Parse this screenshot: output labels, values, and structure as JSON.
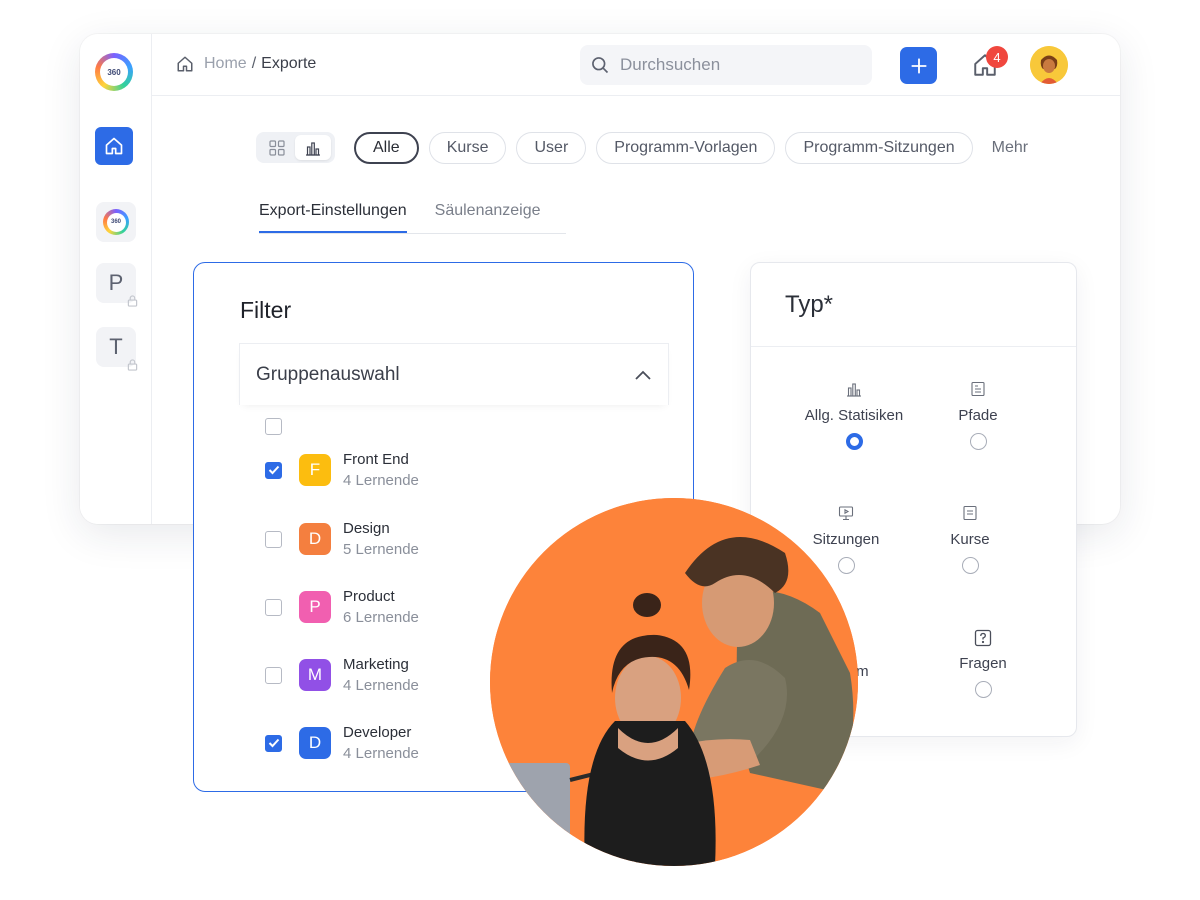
{
  "app": {
    "logo_text": "360"
  },
  "sidebar": {
    "items": [
      {
        "label": "P"
      },
      {
        "label": "T"
      }
    ],
    "logo_small_text": "360"
  },
  "header": {
    "breadcrumb_home": "Home",
    "breadcrumb_separator": "/",
    "breadcrumb_current": "Exporte",
    "search_placeholder": "Durchsuchen",
    "notification_count": "4"
  },
  "filters": {
    "chips": [
      "Alle",
      "Kurse",
      "User",
      "Programm-Vorlagen",
      "Programm-Sitzungen"
    ],
    "active_chip": "Alle",
    "more_label": "Mehr"
  },
  "tabs": {
    "items": [
      "Export-Einstellungen",
      "Säulenanzeige"
    ],
    "active": "Export-Einstellungen"
  },
  "filter_panel": {
    "title": "Filter",
    "group_select_label": "Gruppenauswahl",
    "groups": [
      {
        "initial": "F",
        "name": "Front End",
        "count": "4 Lernende",
        "checked": true,
        "color": "#fcbd0f"
      },
      {
        "initial": "D",
        "name": "Design",
        "count": "5 Lernende",
        "checked": false,
        "color": "#f47f3f"
      },
      {
        "initial": "P",
        "name": "Product",
        "count": "6 Lernende",
        "checked": false,
        "color": "#f15fb0"
      },
      {
        "initial": "M",
        "name": "Marketing",
        "count": "4 Lernende",
        "checked": false,
        "color": "#9150e6"
      },
      {
        "initial": "D",
        "name": "Developer",
        "count": "4 Lernende",
        "checked": true,
        "color": "#2d6be6"
      }
    ]
  },
  "type_panel": {
    "title": "Typ*",
    "options": [
      {
        "label": "Allg. Statisiken",
        "icon": "bar-chart-icon",
        "selected": true
      },
      {
        "label": "Pfade",
        "icon": "document-icon",
        "selected": false
      },
      {
        "label": "Sitzungen",
        "icon": "monitor-icon",
        "selected": false
      },
      {
        "label": "Kurse",
        "icon": "course-icon",
        "selected": false
      },
      {
        "label": "aum",
        "icon": "",
        "selected": false
      },
      {
        "label": "Fragen",
        "icon": "question-icon",
        "selected": false
      }
    ]
  },
  "colors": {
    "accent": "#2d6be6",
    "badge": "#f0473e",
    "photo_bg": "#fd833a"
  }
}
